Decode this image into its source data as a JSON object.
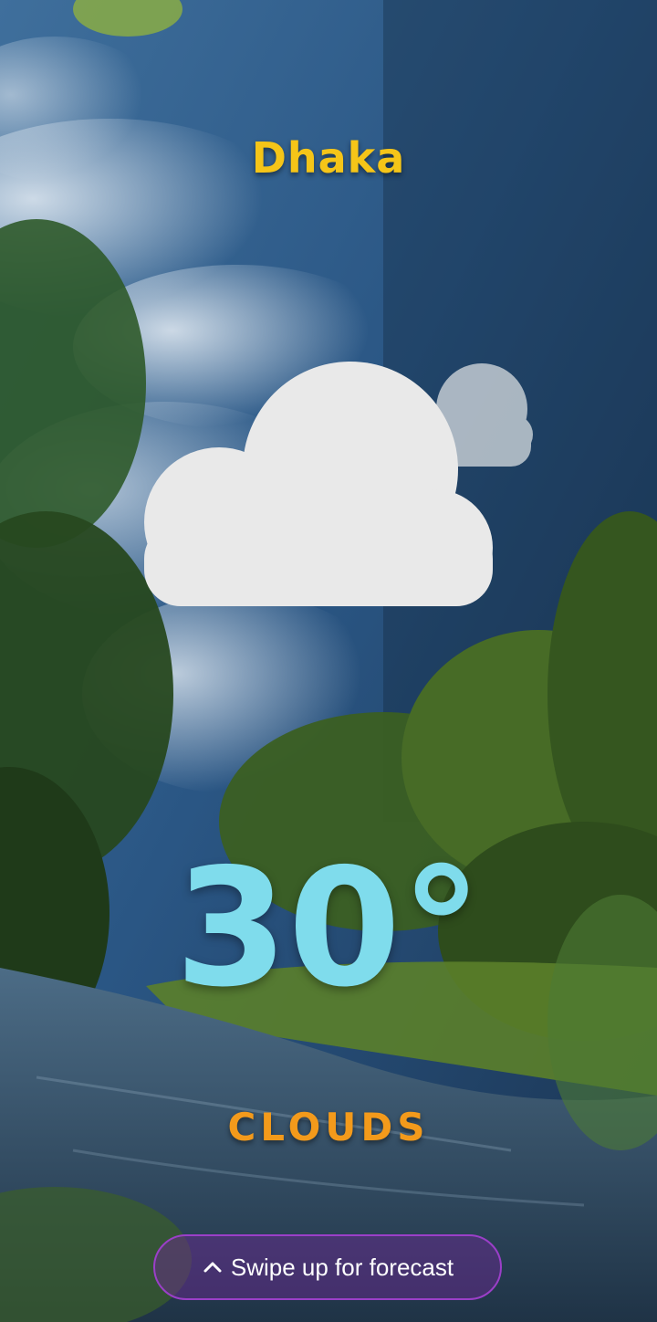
{
  "location": {
    "city": "Dhaka"
  },
  "current": {
    "temperature": "30°",
    "condition": "CLOUDS",
    "icon": "partly-cloudy-icon"
  },
  "forecast_prompt": {
    "label": "Swipe up for forecast",
    "icon": "chevron-up-icon"
  },
  "background": {
    "scene": "rainforest river under cloudy sky"
  },
  "colors": {
    "city": "#f5c518",
    "temperature": "#7fdcec",
    "condition": "#f39a1b",
    "button_border": "#9b3fc8",
    "button_text": "#ffffff"
  }
}
